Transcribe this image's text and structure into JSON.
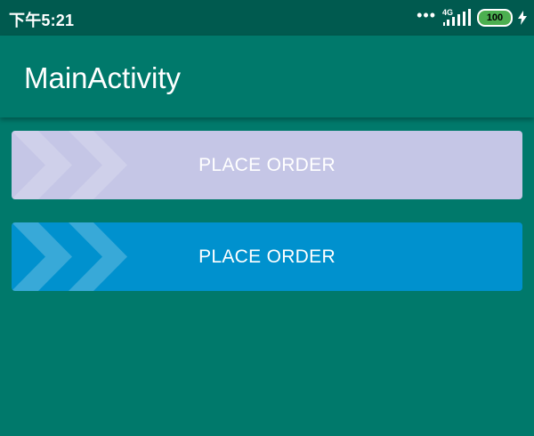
{
  "status_bar": {
    "time": "下午5:21",
    "more_dots": "•••",
    "network": "4G",
    "battery": "100"
  },
  "app_bar": {
    "title": "MainActivity"
  },
  "buttons": [
    {
      "label": "PLACE ORDER"
    },
    {
      "label": "PLACE ORDER"
    }
  ],
  "colors": {
    "status_bar": "#005a4f",
    "app_bar": "#00796b",
    "background": "#00796b",
    "button_1": "#c5c6e6",
    "button_2": "#0091ce",
    "battery": "#4caf50"
  },
  "icons": {
    "status": [
      "dots-icon",
      "signal-icon",
      "battery-icon",
      "charging-bolt-icon"
    ],
    "buttons": [
      "chevron-arrows-icon"
    ]
  }
}
